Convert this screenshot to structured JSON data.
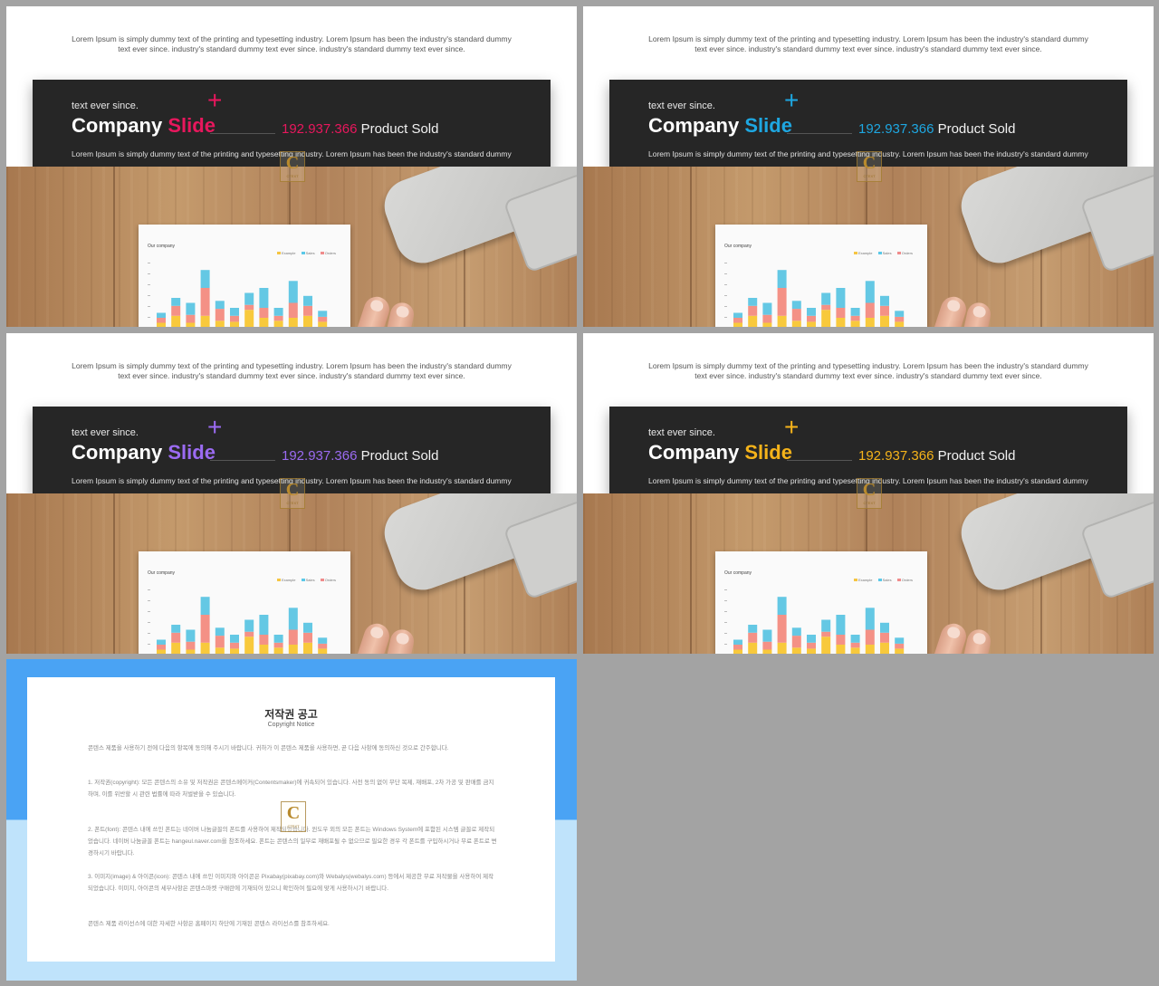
{
  "slides": [
    {
      "kicker": "text ever since.",
      "title_a": "Company",
      "title_b": "Slide",
      "number": "192.937.366",
      "stat_label": "Product Sold",
      "accent": "#e8175d",
      "plus": "+"
    },
    {
      "kicker": "text ever since.",
      "title_a": "Company",
      "title_b": "Slide",
      "number": "192.937.366",
      "stat_label": "Product Sold",
      "accent": "#1ea7e1",
      "plus": "+"
    },
    {
      "kicker": "text ever since.",
      "title_a": "Company",
      "title_b": "Slide",
      "number": "192.937.366",
      "stat_label": "Product Sold",
      "accent": "#9b6bf2",
      "plus": "+"
    },
    {
      "kicker": "text ever since.",
      "title_a": "Company",
      "title_b": "Slide",
      "number": "192.937.366",
      "stat_label": "Product Sold",
      "accent": "#f5b31a",
      "plus": "+"
    }
  ],
  "common": {
    "top_text_1": "Lorem Ipsum is simply dummy text of the printing and typesetting industry.  Lorem Ipsum has been the industry's standard dummy",
    "top_text_2": "text ever since. industry's standard dummy text ever since. industry's standard dummy text ever since.",
    "panel_text": "Lorem Ipsum is simply dummy text of the printing and typesetting industry.  Lorem Ipsum has been the industry's standard dummy",
    "paper_title": "Our company",
    "legend": [
      "Example",
      "Sales",
      "Orders"
    ],
    "legend_colors": [
      "#f5c542",
      "#5bc8e8",
      "#f08c8c"
    ]
  },
  "paper_chart": {
    "type": "bar",
    "series_colors": [
      "#f8c93c",
      "#f49186",
      "#64c8e4"
    ],
    "stacks": [
      [
        5,
        5,
        5
      ],
      [
        12,
        10,
        8
      ],
      [
        5,
        8,
        12
      ],
      [
        12,
        28,
        18
      ],
      [
        7,
        12,
        8
      ],
      [
        6,
        6,
        8
      ],
      [
        18,
        5,
        12
      ],
      [
        10,
        10,
        20
      ],
      [
        7,
        5,
        8
      ],
      [
        10,
        15,
        22
      ],
      [
        12,
        10,
        10
      ],
      [
        6,
        5,
        6
      ]
    ]
  },
  "watermark": {
    "letter": "C",
    "sub": "CTEXT"
  },
  "notice": {
    "title": "저작권 공고",
    "subtitle": "Copyright Notice",
    "paragraphs": [
      "콘텐스 제품을 사용하기 전에 다음의 항목에 동의해 주시기 바랍니다. 귀하가 이 콘텐스 제품을 사용하면, 곧 다음 사항에 동의하신 것으로 간주합니다.",
      "1. 저작권(copyright): 모든 콘텐스의 소유 및 저작권은 콘텐스메이커(Contentsmaker)에 귀속되어 있습니다. 사전 동의 없이 무단 복제, 재배포, 2차 가공 및 판매를 금지하며, 이를 위반할 시 관련 법률에 따라 처벌받을 수 있습니다.",
      "2. 폰트(font): 콘텐스 내에 쓰인 폰트는 네이버 나눔글꼴의 폰트를 사용하여 제작되었습니다. 윈도우 외의 모든 폰트는 Windows System에 포함된 시스템 글꼴로 제작되었습니다. 네이버 나눔글꼴 폰트는 hangeul.naver.com을 참조하세요. 폰트는 콘텐스의 일부로 재배포될 수 없으므로 필요한 경우 각 폰트를 구입하시거나 무료 폰트로 변경하시기 바랍니다.",
      "3. 이미지(image) & 아이콘(icon): 콘텐스 내에 쓰인 이미지와 아이콘은 Pixabay(pixabay.com)와 Webalys(webalys.com) 등에서 제공한 무료 저작물을 사용하여 제작되었습니다. 이미지, 아이콘의 세부사항은 콘텐스마켓 구매란에 기재되어 있으니 확인하여 필요에 맞게 사용하시기 바랍니다.",
      "콘텐스 제품 라이선스에 대한 자세한 사항은 홈페이지 하단에 기재된 콘텐스 라이선스를 참조하세요."
    ]
  }
}
